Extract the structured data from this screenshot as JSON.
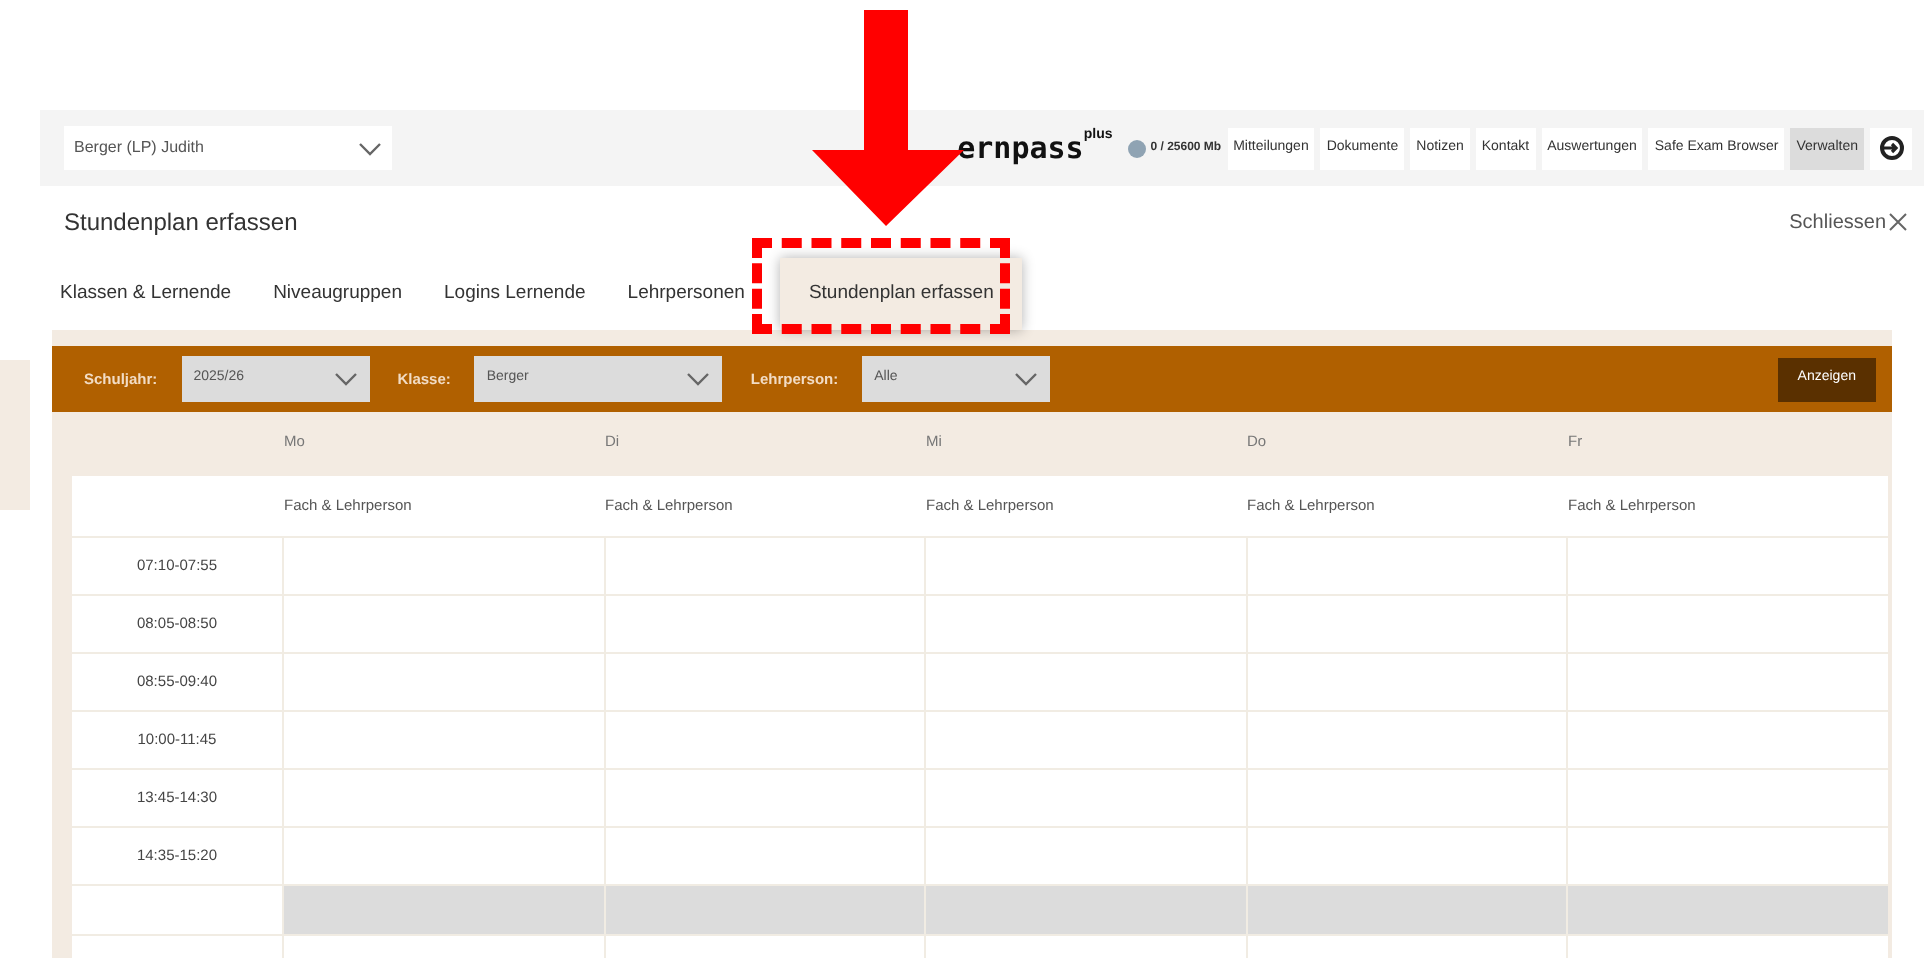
{
  "header": {
    "user_select": "Berger (LP) Judith",
    "logo": {
      "text": "ernpass",
      "superscript": "plus"
    },
    "storage": "0 / 25600 Mb",
    "nav": [
      {
        "label": "Mitteilungen",
        "selected": false
      },
      {
        "label": "Dokumente",
        "selected": false
      },
      {
        "label": "Notizen",
        "selected": false
      },
      {
        "label": "Kontakt",
        "selected": false
      },
      {
        "label": "Auswertungen",
        "selected": false
      },
      {
        "label": "Safe Exam Browser",
        "selected": false
      },
      {
        "label": "Verwalten",
        "selected": true
      }
    ]
  },
  "page": {
    "title": "Stundenplan erfassen",
    "close": "Schliessen"
  },
  "tabs": [
    {
      "label": "Klassen & Lernende",
      "selected": false
    },
    {
      "label": "Niveaugruppen",
      "selected": false
    },
    {
      "label": "Logins Lernende",
      "selected": false
    },
    {
      "label": "Lehrpersonen",
      "selected": false
    },
    {
      "label": "Stundenplan erfassen",
      "selected": true
    }
  ],
  "filters": [
    {
      "label": "Schuljahr:",
      "value": "2025/26"
    },
    {
      "label": "Klasse:",
      "value": "Berger"
    },
    {
      "label": "Lehrperson:",
      "value": "Alle"
    }
  ],
  "show_button": "Anzeigen",
  "days": [
    "Mo",
    "Di",
    "Mi",
    "Do",
    "Fr"
  ],
  "column_headers": [
    "Fach & Lehrperson",
    "Fach & Lehrperson",
    "Fach & Lehrperson",
    "Fach & Lehrperson",
    "Fach & Lehrperson"
  ],
  "rows": [
    {
      "kind": "lesson",
      "time": "07:10-07:55"
    },
    {
      "kind": "lesson",
      "time": "08:05-08:50"
    },
    {
      "kind": "lesson",
      "time": "08:55-09:40"
    },
    {
      "kind": "lesson",
      "time": "10:00-11:45"
    },
    {
      "kind": "lesson",
      "time": "13:45-14:30"
    },
    {
      "kind": "lesson",
      "time": "14:35-15:20"
    },
    {
      "kind": "break"
    },
    {
      "kind": "lesson"
    }
  ]
}
